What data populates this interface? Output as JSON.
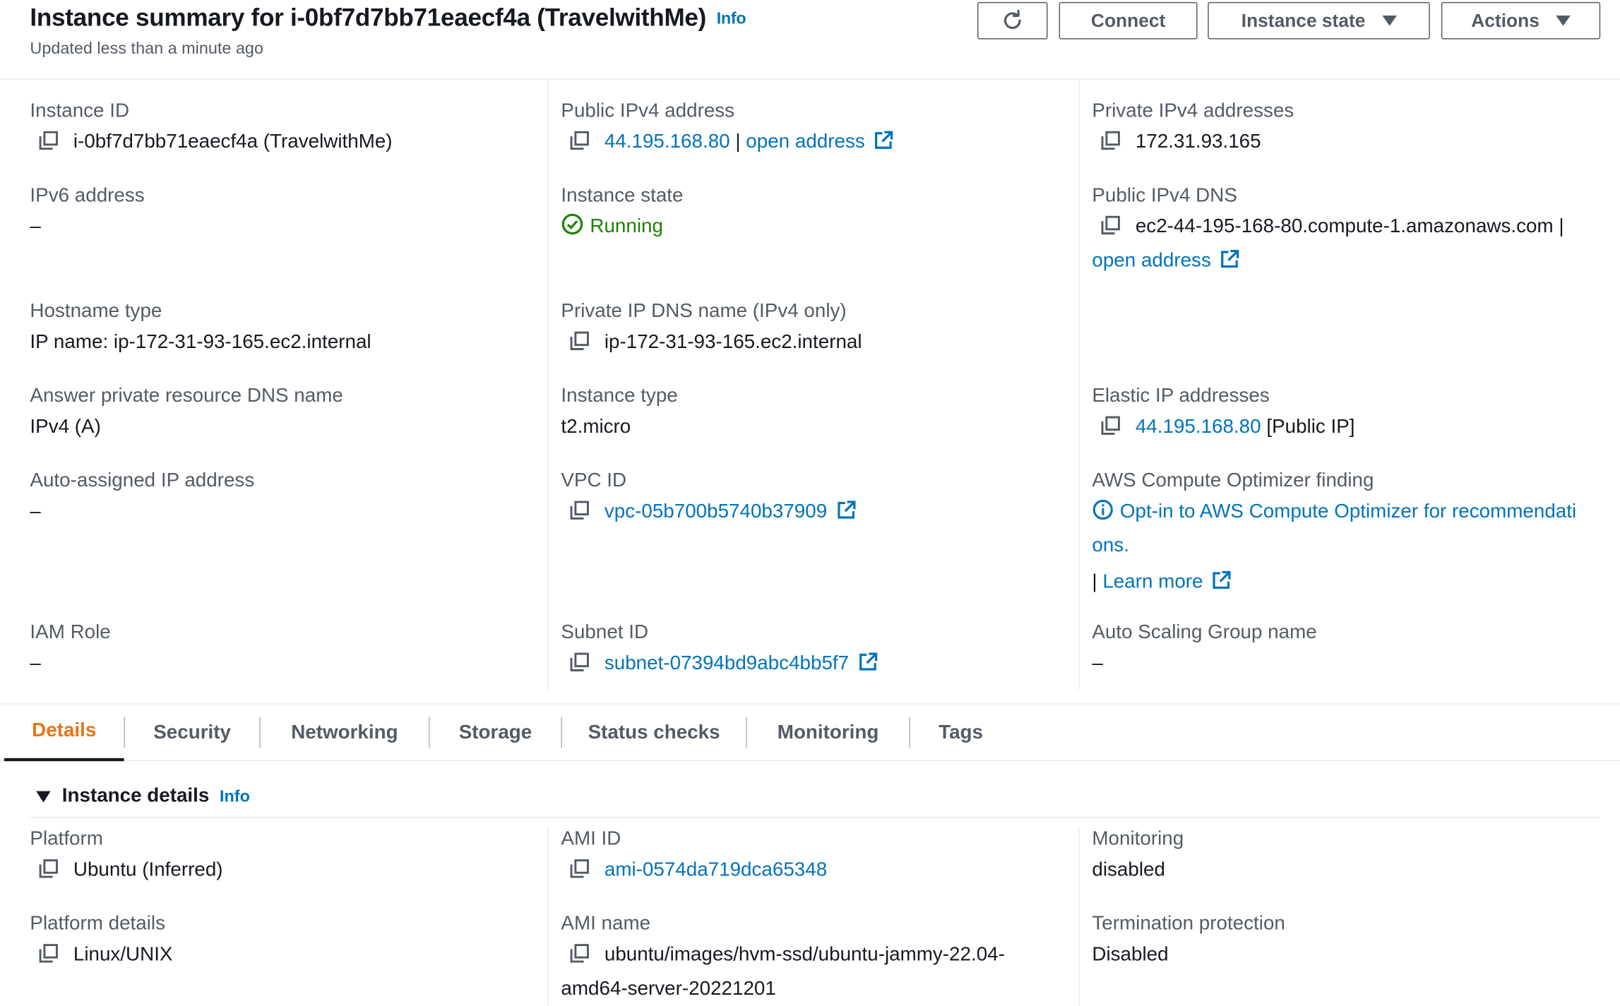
{
  "header": {
    "title": "Instance summary for i-0bf7d7bb71eaecf4a (TravelwithMe)",
    "info": "Info",
    "subtitle": "Updated less than a minute ago",
    "connect": "Connect",
    "instance_state": "Instance state",
    "actions": "Actions"
  },
  "summary": {
    "instance_id": {
      "label": "Instance ID",
      "value": "i-0bf7d7bb71eaecf4a (TravelwithMe)"
    },
    "public_ipv4": {
      "label": "Public IPv4 address",
      "value": "44.195.168.80",
      "sep": "|",
      "open": "open address"
    },
    "private_ipv4": {
      "label": "Private IPv4 addresses",
      "value": "172.31.93.165"
    },
    "ipv6": {
      "label": "IPv6 address",
      "value": "–"
    },
    "instance_state": {
      "label": "Instance state",
      "value": "Running"
    },
    "public_dns": {
      "label": "Public IPv4 DNS",
      "value": "ec2-44-195-168-80.compute-1.amazonaws.com",
      "sep": "|",
      "open": "open address"
    },
    "hostname_type": {
      "label": "Hostname type",
      "value": "IP name: ip-172-31-93-165.ec2.internal"
    },
    "private_dns": {
      "label": "Private IP DNS name (IPv4 only)",
      "value": "ip-172-31-93-165.ec2.internal"
    },
    "answer_dns": {
      "label": "Answer private resource DNS name",
      "value": "IPv4 (A)"
    },
    "instance_type": {
      "label": "Instance type",
      "value": "t2.micro"
    },
    "elastic_ip": {
      "label": "Elastic IP addresses",
      "value": "44.195.168.80",
      "suffix": "[Public IP]"
    },
    "auto_ip": {
      "label": "Auto-assigned IP address",
      "value": "–"
    },
    "vpc_id": {
      "label": "VPC ID",
      "value": "vpc-05b700b5740b37909"
    },
    "optimizer": {
      "label": "AWS Compute Optimizer finding",
      "line1": "Opt-in to AWS Compute Optimizer for recommendati",
      "line2": "ons.",
      "sep": "|",
      "learn": "Learn more"
    },
    "iam_role": {
      "label": "IAM Role",
      "value": "–"
    },
    "subnet_id": {
      "label": "Subnet ID",
      "value": "subnet-07394bd9abc4bb5f7"
    },
    "asg_name": {
      "label": "Auto Scaling Group name",
      "value": "–"
    }
  },
  "tabs": [
    "Details",
    "Security",
    "Networking",
    "Storage",
    "Status checks",
    "Monitoring",
    "Tags"
  ],
  "details": {
    "title": "Instance details",
    "info": "Info",
    "platform": {
      "label": "Platform",
      "value": "Ubuntu (Inferred)"
    },
    "ami_id": {
      "label": "AMI ID",
      "value": "ami-0574da719dca65348"
    },
    "monitoring": {
      "label": "Monitoring",
      "value": "disabled"
    },
    "platform_details": {
      "label": "Platform details",
      "value": "Linux/UNIX"
    },
    "ami_name": {
      "label": "AMI name",
      "line1": "ubuntu/images/hvm-ssd/ubuntu-jammy-22.04-",
      "line2": "amd64-server-20221201"
    },
    "termination": {
      "label": "Termination protection",
      "value": "Disabled"
    }
  },
  "colors": {
    "link": "#0073bb",
    "running": "#1d8102",
    "active_tab": "#ec7211",
    "muted": "#545b64"
  }
}
